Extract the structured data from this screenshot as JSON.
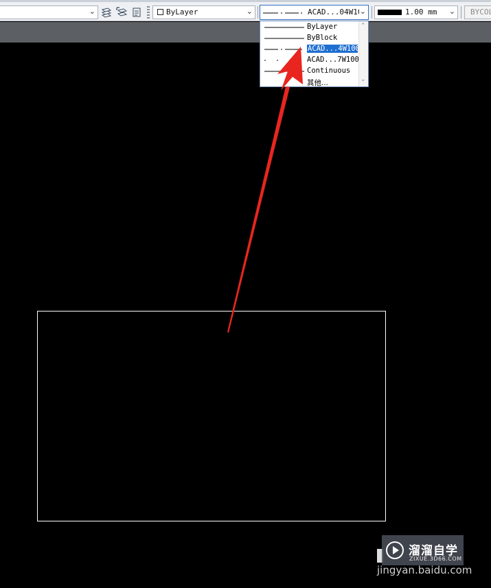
{
  "toolbar": {
    "color_label": "ByLayer",
    "linetype_label": "ACAD...04W10(",
    "lineweight_label": "1.00 mm",
    "plotstyle_label": "BYCOL"
  },
  "linetype_dropdown": {
    "items": [
      {
        "label": "ByLayer",
        "line": "solid"
      },
      {
        "label": "ByBlock",
        "line": "solid"
      },
      {
        "label": "ACAD...4W100",
        "line": "dashdot",
        "selected": true
      },
      {
        "label": "ACAD...7W100",
        "line": "sparse"
      },
      {
        "label": "Continuous",
        "line": "solid"
      },
      {
        "label": "其他...",
        "line": "none"
      }
    ]
  },
  "annotation": {
    "color": "#e8261f"
  },
  "watermark": {
    "title": "溜溜自学",
    "url": "ZIXUE.3D66.COM",
    "site": "jingyan.baidu.com"
  },
  "colors": {
    "selection": "#1f6fd1",
    "canvas": "#000000",
    "toolbar": "#eef0f3"
  }
}
